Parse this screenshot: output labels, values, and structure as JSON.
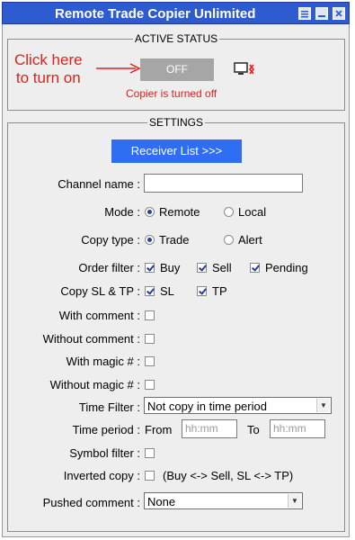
{
  "window": {
    "title": "Remote Trade Copier Unlimited"
  },
  "active_status": {
    "legend": "ACTIVE STATUS",
    "hint_line1": "Click here",
    "hint_line2": "to turn on",
    "toggle_label": "OFF",
    "status_text": "Copier is turned off"
  },
  "settings": {
    "legend": "SETTINGS",
    "receiver_button": "Receiver List >>>",
    "channel_name": {
      "label": "Channel name :",
      "value": ""
    },
    "mode": {
      "label": "Mode :",
      "options": [
        "Remote",
        "Local"
      ],
      "selected": "Remote"
    },
    "copy_type": {
      "label": "Copy type :",
      "options": [
        "Trade",
        "Alert"
      ],
      "selected": "Trade"
    },
    "order_filter": {
      "label": "Order filter :",
      "items": [
        {
          "label": "Buy",
          "checked": true
        },
        {
          "label": "Sell",
          "checked": true
        },
        {
          "label": "Pending",
          "checked": true
        }
      ]
    },
    "copy_sl_tp": {
      "label": "Copy SL & TP :",
      "items": [
        {
          "label": "SL",
          "checked": true
        },
        {
          "label": "TP",
          "checked": true
        }
      ]
    },
    "with_comment": {
      "label": "With comment :",
      "checked": false
    },
    "without_comment": {
      "label": "Without comment :",
      "checked": false
    },
    "with_magic": {
      "label": "With magic # :",
      "checked": false
    },
    "without_magic": {
      "label": "Without magic # :",
      "checked": false
    },
    "time_filter": {
      "label": "Time Filter :",
      "selected": "Not copy in time period"
    },
    "time_period": {
      "label": "Time period :",
      "from_label": "From",
      "from_placeholder": "hh:mm",
      "to_label": "To",
      "to_placeholder": "hh:mm"
    },
    "symbol_filter": {
      "label": "Symbol filter :",
      "checked": false
    },
    "inverted_copy": {
      "label": "Inverted copy :",
      "checked": false,
      "note": "(Buy <-> Sell, SL <-> TP)"
    },
    "pushed_comment": {
      "label": "Pushed comment :",
      "selected": "None"
    }
  },
  "colors": {
    "title_bar": "#2f5bd1",
    "accent_button": "#2f6ef2",
    "status_red": "#e0201f",
    "toggle_off": "#a6a6a6",
    "panel_bg": "#eeeeee"
  }
}
